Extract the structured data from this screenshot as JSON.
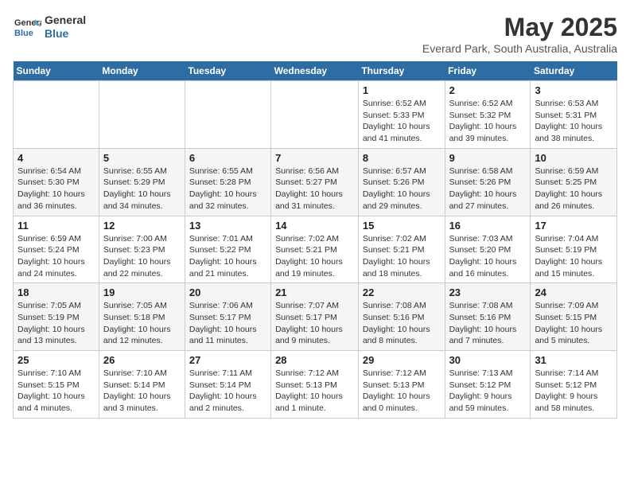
{
  "header": {
    "logo_line1": "General",
    "logo_line2": "Blue",
    "title": "May 2025",
    "subtitle": "Everard Park, South Australia, Australia"
  },
  "days_of_week": [
    "Sunday",
    "Monday",
    "Tuesday",
    "Wednesday",
    "Thursday",
    "Friday",
    "Saturday"
  ],
  "weeks": [
    [
      {
        "num": "",
        "info": ""
      },
      {
        "num": "",
        "info": ""
      },
      {
        "num": "",
        "info": ""
      },
      {
        "num": "",
        "info": ""
      },
      {
        "num": "1",
        "info": "Sunrise: 6:52 AM\nSunset: 5:33 PM\nDaylight: 10 hours\nand 41 minutes."
      },
      {
        "num": "2",
        "info": "Sunrise: 6:52 AM\nSunset: 5:32 PM\nDaylight: 10 hours\nand 39 minutes."
      },
      {
        "num": "3",
        "info": "Sunrise: 6:53 AM\nSunset: 5:31 PM\nDaylight: 10 hours\nand 38 minutes."
      }
    ],
    [
      {
        "num": "4",
        "info": "Sunrise: 6:54 AM\nSunset: 5:30 PM\nDaylight: 10 hours\nand 36 minutes."
      },
      {
        "num": "5",
        "info": "Sunrise: 6:55 AM\nSunset: 5:29 PM\nDaylight: 10 hours\nand 34 minutes."
      },
      {
        "num": "6",
        "info": "Sunrise: 6:55 AM\nSunset: 5:28 PM\nDaylight: 10 hours\nand 32 minutes."
      },
      {
        "num": "7",
        "info": "Sunrise: 6:56 AM\nSunset: 5:27 PM\nDaylight: 10 hours\nand 31 minutes."
      },
      {
        "num": "8",
        "info": "Sunrise: 6:57 AM\nSunset: 5:26 PM\nDaylight: 10 hours\nand 29 minutes."
      },
      {
        "num": "9",
        "info": "Sunrise: 6:58 AM\nSunset: 5:26 PM\nDaylight: 10 hours\nand 27 minutes."
      },
      {
        "num": "10",
        "info": "Sunrise: 6:59 AM\nSunset: 5:25 PM\nDaylight: 10 hours\nand 26 minutes."
      }
    ],
    [
      {
        "num": "11",
        "info": "Sunrise: 6:59 AM\nSunset: 5:24 PM\nDaylight: 10 hours\nand 24 minutes."
      },
      {
        "num": "12",
        "info": "Sunrise: 7:00 AM\nSunset: 5:23 PM\nDaylight: 10 hours\nand 22 minutes."
      },
      {
        "num": "13",
        "info": "Sunrise: 7:01 AM\nSunset: 5:22 PM\nDaylight: 10 hours\nand 21 minutes."
      },
      {
        "num": "14",
        "info": "Sunrise: 7:02 AM\nSunset: 5:21 PM\nDaylight: 10 hours\nand 19 minutes."
      },
      {
        "num": "15",
        "info": "Sunrise: 7:02 AM\nSunset: 5:21 PM\nDaylight: 10 hours\nand 18 minutes."
      },
      {
        "num": "16",
        "info": "Sunrise: 7:03 AM\nSunset: 5:20 PM\nDaylight: 10 hours\nand 16 minutes."
      },
      {
        "num": "17",
        "info": "Sunrise: 7:04 AM\nSunset: 5:19 PM\nDaylight: 10 hours\nand 15 minutes."
      }
    ],
    [
      {
        "num": "18",
        "info": "Sunrise: 7:05 AM\nSunset: 5:19 PM\nDaylight: 10 hours\nand 13 minutes."
      },
      {
        "num": "19",
        "info": "Sunrise: 7:05 AM\nSunset: 5:18 PM\nDaylight: 10 hours\nand 12 minutes."
      },
      {
        "num": "20",
        "info": "Sunrise: 7:06 AM\nSunset: 5:17 PM\nDaylight: 10 hours\nand 11 minutes."
      },
      {
        "num": "21",
        "info": "Sunrise: 7:07 AM\nSunset: 5:17 PM\nDaylight: 10 hours\nand 9 minutes."
      },
      {
        "num": "22",
        "info": "Sunrise: 7:08 AM\nSunset: 5:16 PM\nDaylight: 10 hours\nand 8 minutes."
      },
      {
        "num": "23",
        "info": "Sunrise: 7:08 AM\nSunset: 5:16 PM\nDaylight: 10 hours\nand 7 minutes."
      },
      {
        "num": "24",
        "info": "Sunrise: 7:09 AM\nSunset: 5:15 PM\nDaylight: 10 hours\nand 5 minutes."
      }
    ],
    [
      {
        "num": "25",
        "info": "Sunrise: 7:10 AM\nSunset: 5:15 PM\nDaylight: 10 hours\nand 4 minutes."
      },
      {
        "num": "26",
        "info": "Sunrise: 7:10 AM\nSunset: 5:14 PM\nDaylight: 10 hours\nand 3 minutes."
      },
      {
        "num": "27",
        "info": "Sunrise: 7:11 AM\nSunset: 5:14 PM\nDaylight: 10 hours\nand 2 minutes."
      },
      {
        "num": "28",
        "info": "Sunrise: 7:12 AM\nSunset: 5:13 PM\nDaylight: 10 hours\nand 1 minute."
      },
      {
        "num": "29",
        "info": "Sunrise: 7:12 AM\nSunset: 5:13 PM\nDaylight: 10 hours\nand 0 minutes."
      },
      {
        "num": "30",
        "info": "Sunrise: 7:13 AM\nSunset: 5:12 PM\nDaylight: 9 hours\nand 59 minutes."
      },
      {
        "num": "31",
        "info": "Sunrise: 7:14 AM\nSunset: 5:12 PM\nDaylight: 9 hours\nand 58 minutes."
      }
    ]
  ]
}
